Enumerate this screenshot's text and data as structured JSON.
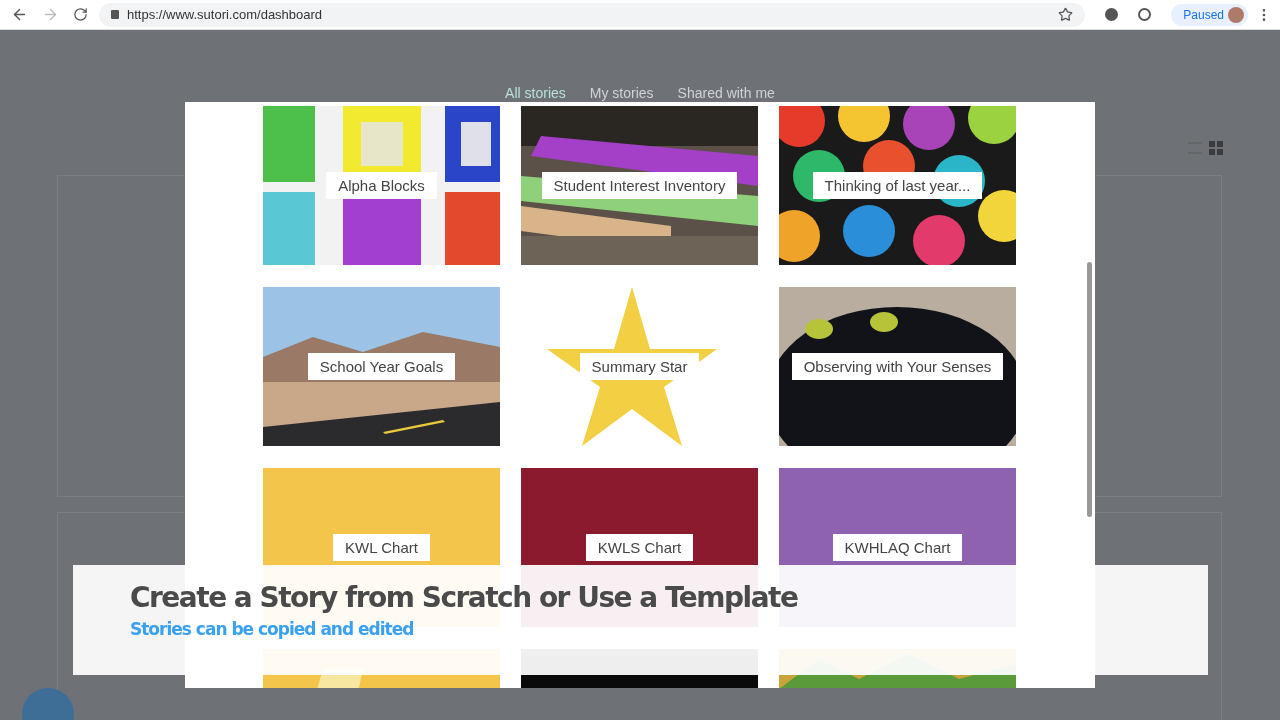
{
  "browser": {
    "url": "https://www.sutori.com/dashboard",
    "profile_label": "Paused"
  },
  "dashboard": {
    "tabs": [
      {
        "label": "All stories",
        "selected": true
      },
      {
        "label": "My stories",
        "selected": false
      },
      {
        "label": "Shared with me",
        "selected": false
      }
    ]
  },
  "templates": [
    {
      "title": "Alpha Blocks",
      "kind": "picture"
    },
    {
      "title": "Student Interest Inventory",
      "kind": "picture"
    },
    {
      "title": "Thinking of last year...",
      "kind": "picture"
    },
    {
      "title": "School Year Goals",
      "kind": "picture"
    },
    {
      "title": "Summary Star",
      "kind": "star"
    },
    {
      "title": "Observing with Your Senses",
      "kind": "picture"
    },
    {
      "title": "KWL Chart",
      "kind": "solid",
      "color": "#f3c64b"
    },
    {
      "title": "KWLS Chart",
      "kind": "solid",
      "color": "#8c1a2e"
    },
    {
      "title": "KWHLAQ Chart",
      "kind": "solid",
      "color": "#8e62ae"
    },
    {
      "kind": "picture"
    },
    {
      "kind": "picture"
    },
    {
      "kind": "picture"
    }
  ],
  "caption": {
    "title": "Create a Story from Scratch or Use a Template",
    "subtitle": "Stories can be copied and edited"
  }
}
